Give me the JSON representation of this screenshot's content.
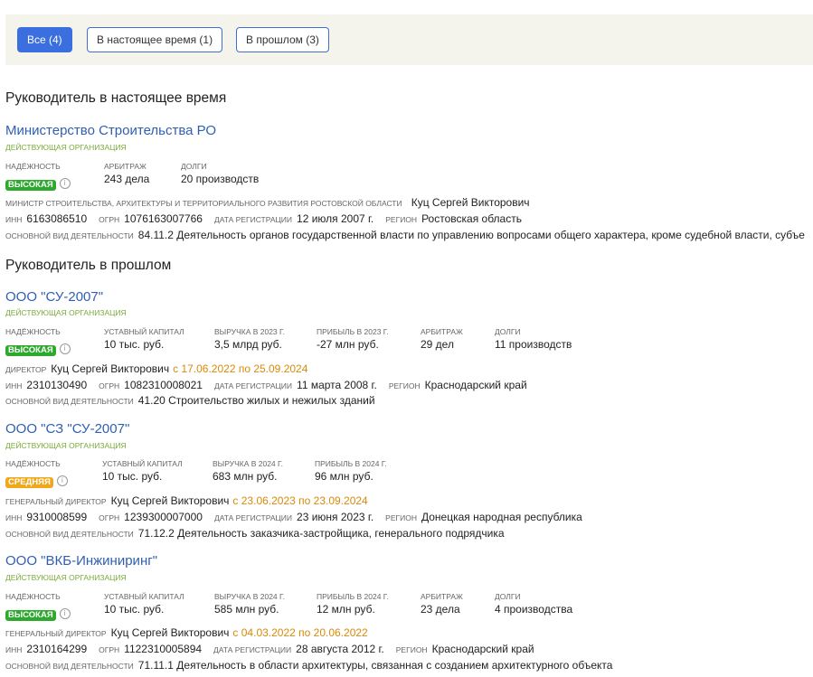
{
  "filters": [
    {
      "label": "Все (4)",
      "active": true
    },
    {
      "label": "В настоящее время (1)",
      "active": false
    },
    {
      "label": "В прошлом (3)",
      "active": false
    }
  ],
  "sections": {
    "current": "Руководитель в настоящее время",
    "past": "Руководитель в прошлом"
  },
  "labels": {
    "reliability": "НАДЁЖНОСТЬ",
    "arbitration": "АРБИТРАЖ",
    "debts": "ДОЛГИ",
    "capital": "УСТАВНЫЙ КАПИТАЛ",
    "inn": "ИНН",
    "ogrn": "ОГРН",
    "reg_date": "ДАТА РЕГИСТРАЦИИ",
    "region": "РЕГИОН",
    "activity": "ОСНОВНОЙ ВИД ДЕЯТЕЛЬНОСТИ"
  },
  "orgs": [
    {
      "name": "Министерство Строительства РО",
      "status": "ДЕЙСТВУЮЩАЯ ОРГАНИЗАЦИЯ",
      "reliability": "ВЫСОКАЯ",
      "arbitration": "243 дела",
      "debts": "20 производств",
      "role": "МИНИСТР СТРОИТЕЛЬСТВА, АРХИТЕКТУРЫ И ТЕРРИТОРИАЛЬНОГО РАЗВИТИЯ РОСТОВСКОЙ ОБЛАСТИ",
      "person": "Куц Сергей Викторович",
      "period": "",
      "inn": "6163086510",
      "ogrn": "1076163007766",
      "reg_date": "12 июля 2007 г.",
      "region": "Ростовская область",
      "activity": "84.11.2 Деятельность органов государственной власти по управлению вопросами общего характера, кроме судебной власти, субъе"
    },
    {
      "name": "ООО \"СУ-2007\"",
      "status": "ДЕЙСТВУЮЩАЯ ОРГАНИЗАЦИЯ",
      "reliability": "ВЫСОКАЯ",
      "capital": "10 тыс. руб.",
      "revenue_label": "ВЫРУЧКА В 2023 Г.",
      "revenue": "3,5 млрд руб.",
      "profit_label": "ПРИБЫЛЬ В 2023 Г.",
      "profit": "-27 млн руб.",
      "arbitration": "29 дел",
      "debts": "11 производств",
      "role": "ДИРЕКТОР",
      "person": "Куц Сергей Викторович",
      "period": "с 17.06.2022 по 25.09.2024",
      "inn": "2310130490",
      "ogrn": "1082310008021",
      "reg_date": "11 марта 2008 г.",
      "region": "Краснодарский край",
      "activity": "41.20 Строительство жилых и нежилых зданий"
    },
    {
      "name": "ООО \"СЗ \"СУ-2007\"",
      "status": "ДЕЙСТВУЮЩАЯ ОРГАНИЗАЦИЯ",
      "reliability": "СРЕДНЯЯ",
      "capital": "10 тыс. руб.",
      "revenue_label": "ВЫРУЧКА В 2024 Г.",
      "revenue": "683 млн руб.",
      "profit_label": "ПРИБЫЛЬ В 2024 Г.",
      "profit": "96 млн руб.",
      "role": "ГЕНЕРАЛЬНЫЙ ДИРЕКТОР",
      "person": "Куц Сергей Викторович",
      "period": "с 23.06.2023 по 23.09.2024",
      "inn": "9310008599",
      "ogrn": "1239300007000",
      "reg_date": "23 июня 2023 г.",
      "region": "Донецкая народная республика",
      "activity": "71.12.2 Деятельность заказчика-застройщика, генерального подрядчика"
    },
    {
      "name": "ООО \"ВКБ-Инжиниринг\"",
      "status": "ДЕЙСТВУЮЩАЯ ОРГАНИЗАЦИЯ",
      "reliability": "ВЫСОКАЯ",
      "capital": "10 тыс. руб.",
      "revenue_label": "ВЫРУЧКА В 2024 Г.",
      "revenue": "585 млн руб.",
      "profit_label": "ПРИБЫЛЬ В 2024 Г.",
      "profit": "12 млн руб.",
      "arbitration": "23 дела",
      "debts": "4 производства",
      "role": "ГЕНЕРАЛЬНЫЙ ДИРЕКТОР",
      "person": "Куц Сергей Викторович",
      "period": "с 04.03.2022 по 20.06.2022",
      "inn": "2310164299",
      "ogrn": "1122310005894",
      "reg_date": "28 августа 2012 г.",
      "region": "Краснодарский край",
      "activity": "71.11.1 Деятельность в области архитектуры, связанная с созданием архитектурного объекта"
    }
  ],
  "info_glyph": "i",
  "colors": {
    "accent": "#3b6fe0",
    "link": "#2f5fb3",
    "status": "#7aab3a",
    "badge_high": "#2daa2d",
    "badge_mid": "#f0a81a",
    "period": "#d98a0a"
  }
}
